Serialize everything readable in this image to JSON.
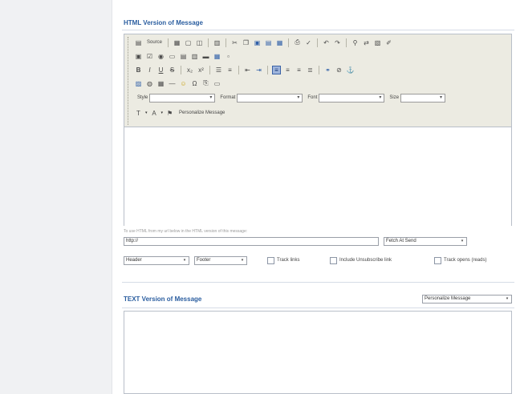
{
  "html_section": {
    "title": "HTML Version of Message",
    "toolbar": {
      "source_label": "Source",
      "style_label": "Style",
      "format_label": "Format",
      "font_label": "Font",
      "size_label": "Size",
      "personalize_label": "Personalize Message"
    },
    "hint": "To use HTML from my url below in the HTML version of this message:",
    "url_value": "http://",
    "fetch_select": "Fetch At Send",
    "header_select": "Header",
    "footer_select": "Footer",
    "option_track_links": "Track links",
    "option_include_unsubscribe": "Include Unsubscribe link",
    "option_track_opens": "Track opens (reads)"
  },
  "text_section": {
    "title": "TEXT Version of Message",
    "personalize_select": "Personalize Message"
  },
  "icons": [
    "source-icon",
    "save-icon",
    "new-page-icon",
    "preview-icon",
    "templates-icon",
    "cut-icon",
    "copy-icon",
    "paste-icon",
    "paste-text-icon",
    "paste-word-icon",
    "print-icon",
    "spellcheck-icon",
    "undo-icon",
    "redo-icon",
    "find-icon",
    "replace-icon",
    "select-all-icon",
    "remove-format-icon",
    "bold-icon",
    "italic-icon",
    "underline-icon",
    "strike-icon",
    "subscript-icon",
    "superscript-icon",
    "ordered-list-icon",
    "unordered-list-icon",
    "outdent-icon",
    "indent-icon",
    "align-left-icon",
    "align-center-icon",
    "align-right-icon",
    "justify-icon",
    "link-icon",
    "unlink-icon",
    "anchor-icon",
    "image-icon",
    "flash-icon",
    "table-icon",
    "rule-icon",
    "smiley-icon",
    "special-char-icon",
    "page-break-icon",
    "text-color-icon",
    "bg-color-icon"
  ],
  "colors": {
    "title_blue": "#2a5d9f",
    "toolbar_bg": "#ecebe2",
    "rail_bg": "#f0f1f3"
  }
}
